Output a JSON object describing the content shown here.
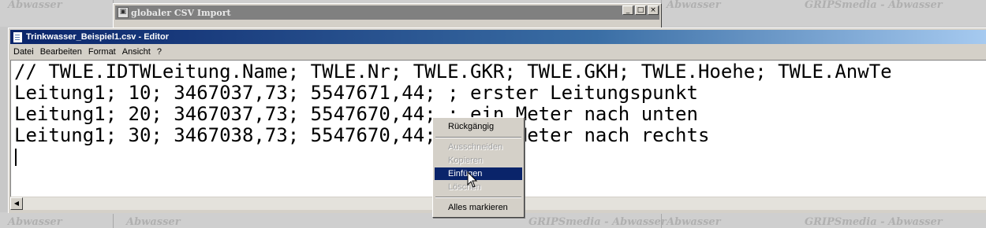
{
  "background": {
    "watermarks": [
      {
        "text": "Abwasser"
      },
      {
        "text": "Abwasser"
      },
      {
        "text": "GRIPSmedia - Abwasser"
      },
      {
        "text": "Abwasser"
      },
      {
        "text": "GRIPSmedia - Abwasser"
      },
      {
        "text": "Abwasser"
      },
      {
        "text": "Abwasser"
      },
      {
        "text": "GRIPSmedia - Abwasser"
      }
    ]
  },
  "csv_window": {
    "title": "globaler CSV Import",
    "buttons": {
      "minimize": "_",
      "maximize": "□",
      "close": "×"
    }
  },
  "editor": {
    "title": "Trinkwasser_Beispiel1.csv - Editor",
    "menu": [
      "Datei",
      "Bearbeiten",
      "Format",
      "Ansicht",
      "?"
    ],
    "lines": [
      "// TWLE.IDTWLeitung.Name; TWLE.Nr; TWLE.GKR; TWLE.GKH; TWLE.Hoehe; TWLE.AnwTe",
      "Leitung1; 10; 3467037,73; 5547671,44; ; erster Leitungspunkt",
      "Leitung1; 20; 3467037,73; 5547670,44; ; ein Meter nach unten",
      "Leitung1; 30; 3467038,73; 5547670,44; ; ein Meter nach rechts"
    ]
  },
  "context_menu": {
    "items": [
      {
        "label": "Rückgängig",
        "state": "enabled"
      },
      {
        "label": "Ausschneiden",
        "state": "disabled"
      },
      {
        "label": "Kopieren",
        "state": "disabled"
      },
      {
        "label": "Einfügen",
        "state": "highlighted"
      },
      {
        "label": "Löschen",
        "state": "disabled"
      },
      {
        "label": "Alles markieren",
        "state": "enabled"
      }
    ]
  },
  "colors": {
    "titlebar_active": "#0a246a",
    "menu_highlight": "#0a246a",
    "face": "#d4d0c8"
  }
}
